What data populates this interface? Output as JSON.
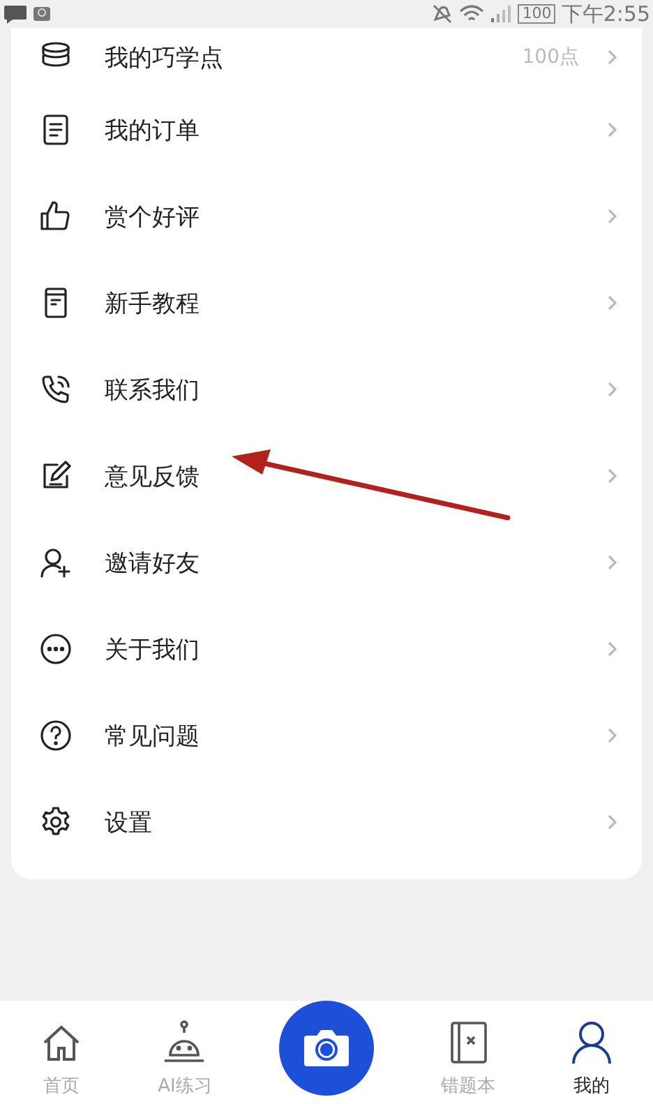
{
  "status_bar": {
    "battery": "100",
    "time": "下午2:55"
  },
  "menu": [
    {
      "label": "我的巧学点",
      "value": "100点"
    },
    {
      "label": "我的订单"
    },
    {
      "label": "赏个好评"
    },
    {
      "label": "新手教程"
    },
    {
      "label": "联系我们"
    },
    {
      "label": "意见反馈"
    },
    {
      "label": "邀请好友"
    },
    {
      "label": "关于我们"
    },
    {
      "label": "常见问题"
    },
    {
      "label": "设置"
    }
  ],
  "tabs": [
    {
      "kind": "home",
      "label": "首页",
      "selected": false
    },
    {
      "kind": "robot",
      "label": "AI练习",
      "selected": false
    },
    {
      "kind": "camera",
      "selected": false
    },
    {
      "kind": "book",
      "label": "错题本",
      "selected": false
    },
    {
      "kind": "person",
      "label": "我的",
      "selected": true
    }
  ]
}
